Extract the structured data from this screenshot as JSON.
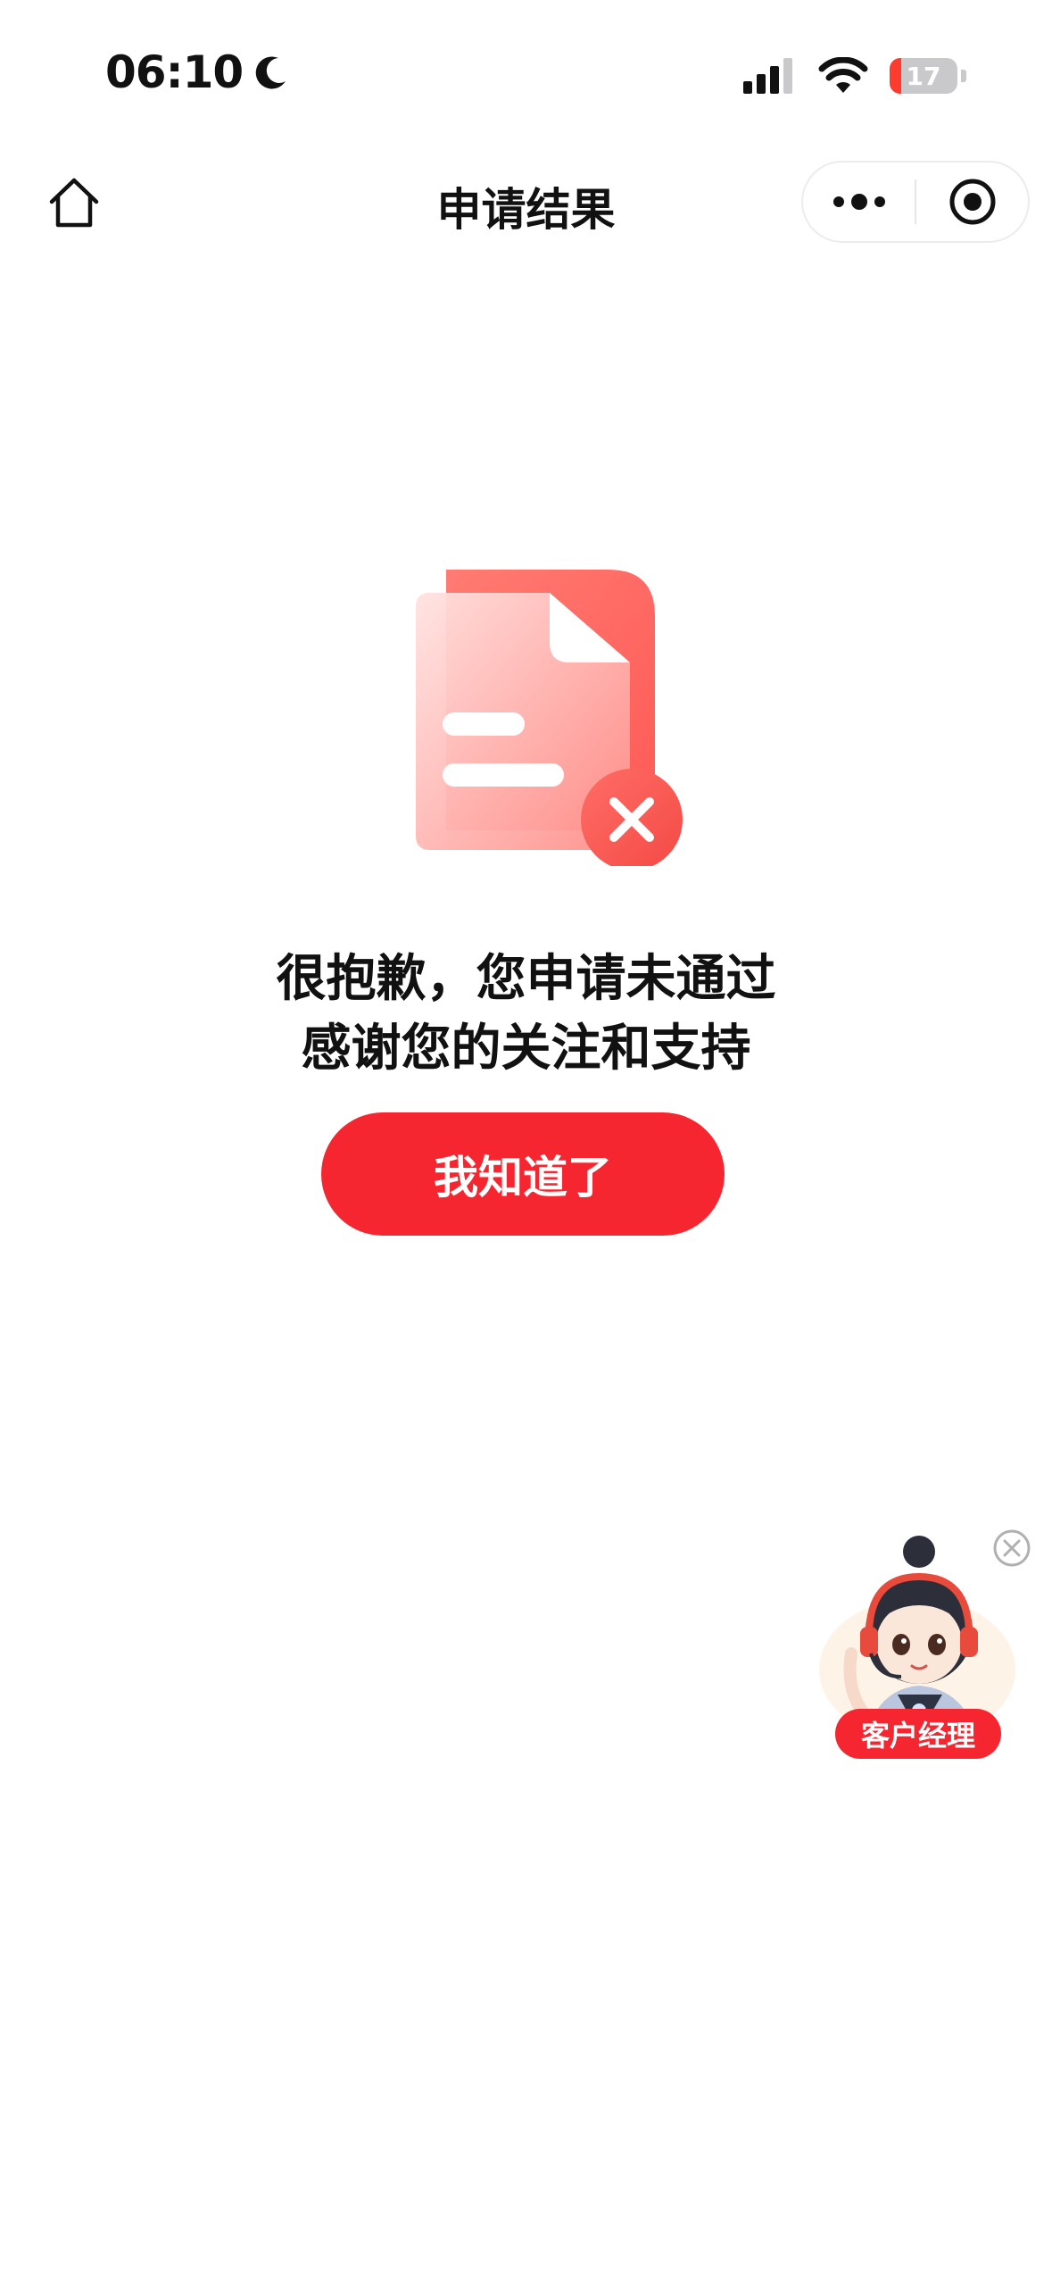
{
  "status_bar": {
    "time": "06:10",
    "battery": "17",
    "battery_fraction": 0.17
  },
  "nav": {
    "title": "申请结果",
    "icons": [
      "home-icon",
      "more-icon",
      "target-icon"
    ]
  },
  "result": {
    "icon": "document-rejected-icon",
    "line1": "很抱歉，您申请未通过",
    "line2": "感谢您的关注和支持",
    "button_label": "我知道了"
  },
  "float_agent": {
    "label": "客户经理",
    "icon": "close-circle-icon"
  },
  "colors": {
    "accent": "#f5262f",
    "illustration": "#ff6b6b"
  }
}
